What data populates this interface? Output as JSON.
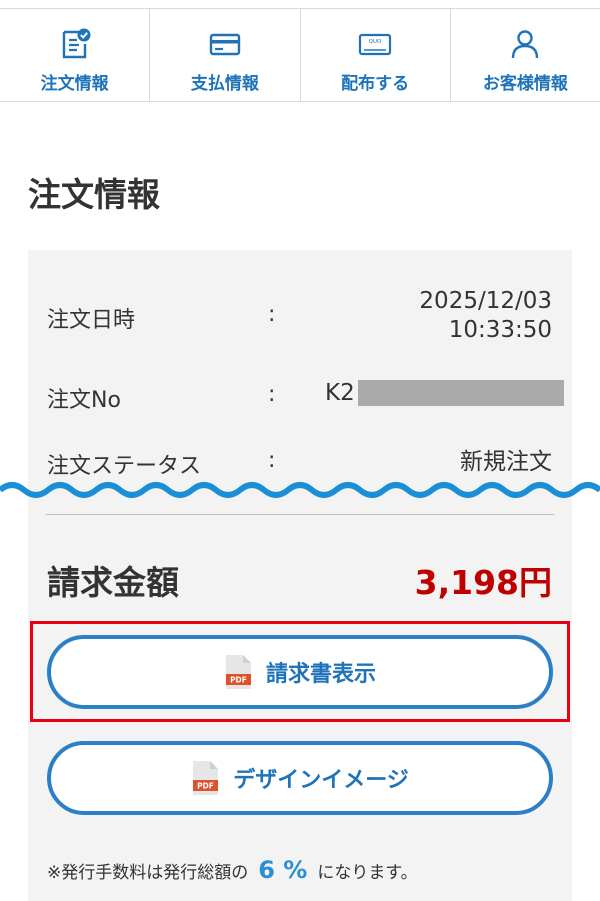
{
  "tabs": [
    {
      "label": "注文情報",
      "icon": "order-doc-icon"
    },
    {
      "label": "支払情報",
      "icon": "credit-card-icon"
    },
    {
      "label": "配布する",
      "icon": "quo-card-icon"
    },
    {
      "label": "お客様情報",
      "icon": "user-icon"
    }
  ],
  "page": {
    "title": "注文情報"
  },
  "order": {
    "date_label": "注文日時",
    "date_value_line1": "2025/12/03",
    "date_value_line2": "10:33:50",
    "no_label": "注文No",
    "no_prefix": "K2",
    "status_label": "注文ステータス",
    "status_value": "新規注文",
    "colon": ":"
  },
  "billing": {
    "label": "請求金額",
    "amount": "3,198円"
  },
  "buttons": {
    "invoice": "請求書表示",
    "design": "デザインイメージ",
    "pdf_badge": "PDF"
  },
  "fee": {
    "prefix": "※発行手数料は発行総額の",
    "percent": "6 %",
    "suffix": "になります。"
  },
  "colors": {
    "accent": "#1f73b8",
    "amount": "#c00000",
    "highlight": "#e60012",
    "wave": "#1a8fd6"
  }
}
